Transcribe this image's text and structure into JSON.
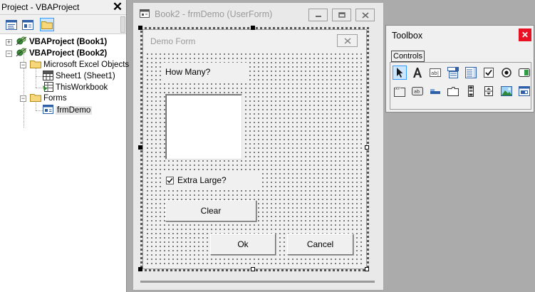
{
  "project_explorer": {
    "title": "Project - VBAProject",
    "close_glyph": "✕",
    "toolbar": [
      "view-code-icon",
      "view-object-icon",
      "toggle-folders-icon"
    ],
    "tree": [
      {
        "label": "VBAProject (Book1)",
        "expander": "+",
        "icon": "vba-project-icon"
      },
      {
        "label": "VBAProject (Book2)",
        "expander": "−",
        "icon": "vba-project-icon"
      },
      {
        "label": "Microsoft Excel Objects",
        "expander": "−",
        "icon": "folder-icon"
      },
      {
        "label": "Sheet1 (Sheet1)",
        "icon": "worksheet-icon"
      },
      {
        "label": "ThisWorkbook",
        "icon": "workbook-icon"
      },
      {
        "label": "Forms",
        "expander": "−",
        "icon": "folder-icon"
      },
      {
        "label": "frmDemo",
        "icon": "userform-icon"
      }
    ]
  },
  "designer": {
    "title": "Book2 - frmDemo (UserForm)",
    "window_buttons": [
      "minimize-icon",
      "restore-icon",
      "close-icon"
    ]
  },
  "form": {
    "caption": "Demo Form",
    "label": "How Many?",
    "checkbox_label": "Extra Large?",
    "checkbox_checked": true,
    "clear_button": "Clear",
    "ok_button": "Ok",
    "cancel_button": "Cancel"
  },
  "toolbox": {
    "title": "Toolbox",
    "close_glyph": "✕",
    "tab": "Controls",
    "tools": [
      "select-objects-icon",
      "label-icon",
      "textbox-icon",
      "combobox-icon",
      "listbox-icon",
      "checkbox-icon",
      "option-button-icon",
      "toggle-button-icon",
      "frame-icon",
      "command-button-icon",
      "tabstrip-icon",
      "multipage-icon",
      "scrollbar-icon",
      "spinbutton-icon",
      "image-icon",
      "refedit-icon"
    ],
    "accent": "#3399ff",
    "close_color": "#e81123"
  }
}
